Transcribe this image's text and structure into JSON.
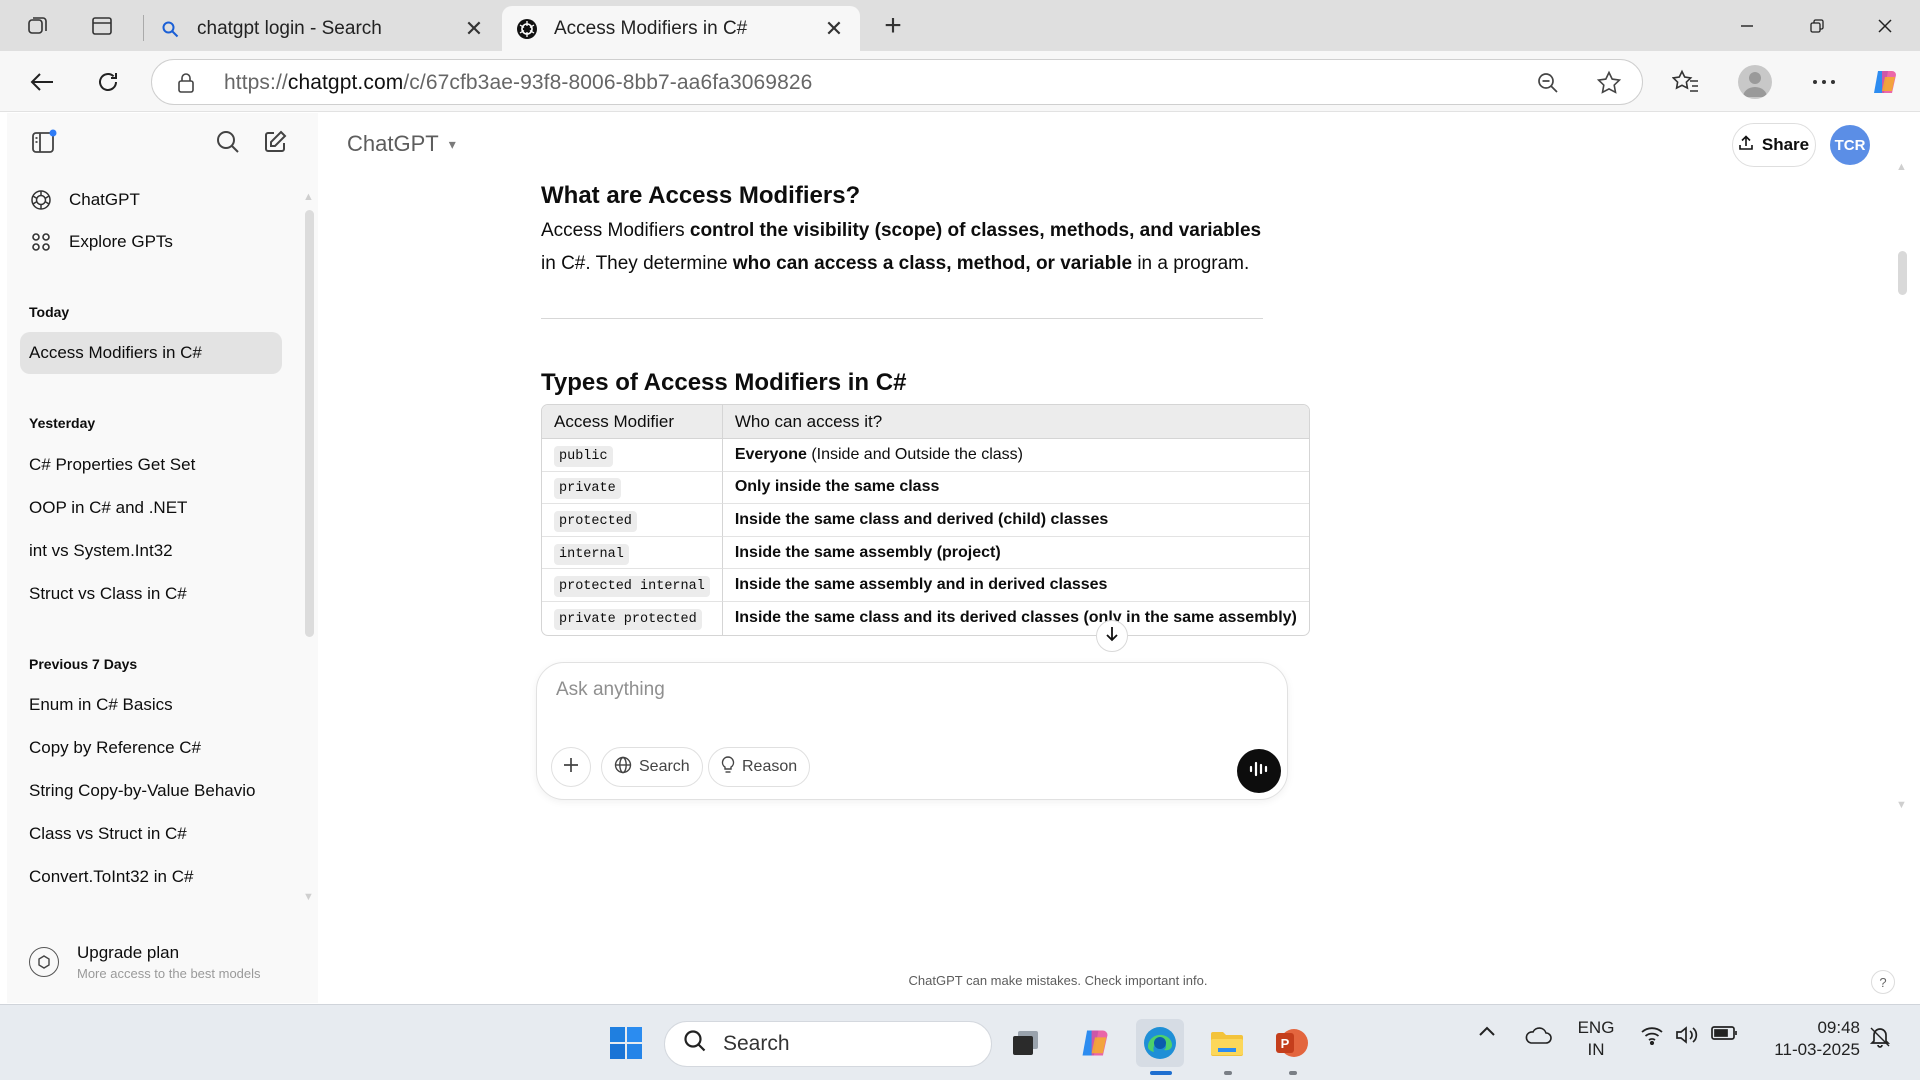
{
  "browser": {
    "tabs": [
      {
        "title": "chatgpt login - Search",
        "favicon": "search-icon"
      },
      {
        "title": "Access Modifiers in C#",
        "favicon": "chatgpt-logo-icon"
      }
    ],
    "address": {
      "prefix": "https://",
      "host": "chatgpt.com",
      "path": "/c/67cfb3ae-93f8-8006-8bb7-aa6fa3069826"
    }
  },
  "sidebar": {
    "nav": [
      {
        "label": "ChatGPT",
        "icon": "chatgpt-logo-icon"
      },
      {
        "label": "Explore GPTs",
        "icon": "grid-icon"
      }
    ],
    "sections": [
      {
        "title": "Today",
        "items": [
          "Access Modifiers in C#"
        ]
      },
      {
        "title": "Yesterday",
        "items": [
          "C# Properties Get Set",
          "OOP in C# and .NET",
          "int vs System.Int32",
          "Struct vs Class in C#"
        ]
      },
      {
        "title": "Previous 7 Days",
        "items": [
          "Enum in C# Basics",
          "Copy by Reference C#",
          "String Copy-by-Value Behavio",
          "Class vs Struct in C#",
          "Convert.ToInt32 in C#"
        ]
      }
    ],
    "upgrade": {
      "title": "Upgrade plan",
      "subtitle": "More access to the best models"
    }
  },
  "header": {
    "model": "ChatGPT",
    "share": "Share",
    "avatar": "TCR"
  },
  "content": {
    "heading1": "What are Access Modifiers?",
    "para": {
      "p1": "Access Modifiers ",
      "b1": "control the visibility (scope) of classes, methods, and variables",
      "p2": " in C#. They determine ",
      "b2": "who can access a class, method, or variable",
      "p3": " in a program."
    },
    "heading2": "Types of Access Modifiers in C#",
    "table": {
      "headers": [
        "Access Modifier",
        "Who can access it?"
      ],
      "rows": [
        {
          "modifier": "public",
          "bold": "Everyone",
          "rest": " (Inside and Outside the class)"
        },
        {
          "modifier": "private",
          "bold": "Only inside the same class",
          "rest": ""
        },
        {
          "modifier": "protected",
          "bold": "Inside the same class and derived (child) classes",
          "rest": ""
        },
        {
          "modifier": "internal",
          "bold": "Inside the same assembly (project)",
          "rest": ""
        },
        {
          "modifier": "protected internal",
          "bold": "Inside the same assembly and in derived classes",
          "rest": ""
        },
        {
          "modifier": "private protected",
          "bold": "Inside the same class and its derived classes (only in the same assembly)",
          "rest": ""
        }
      ]
    }
  },
  "composer": {
    "placeholder": "Ask anything",
    "search": "Search",
    "reason": "Reason"
  },
  "disclaimer": "ChatGPT can make mistakes. Check important info.",
  "help": "?",
  "taskbar": {
    "search_placeholder": "Search",
    "lang1": "ENG",
    "lang2": "IN",
    "time": "09:48",
    "date": "11-03-2025"
  },
  "colors": {
    "avatar": "#5b8ee6",
    "selected_item": "#e3e3e3",
    "taskbar": "#e7ebf0"
  }
}
